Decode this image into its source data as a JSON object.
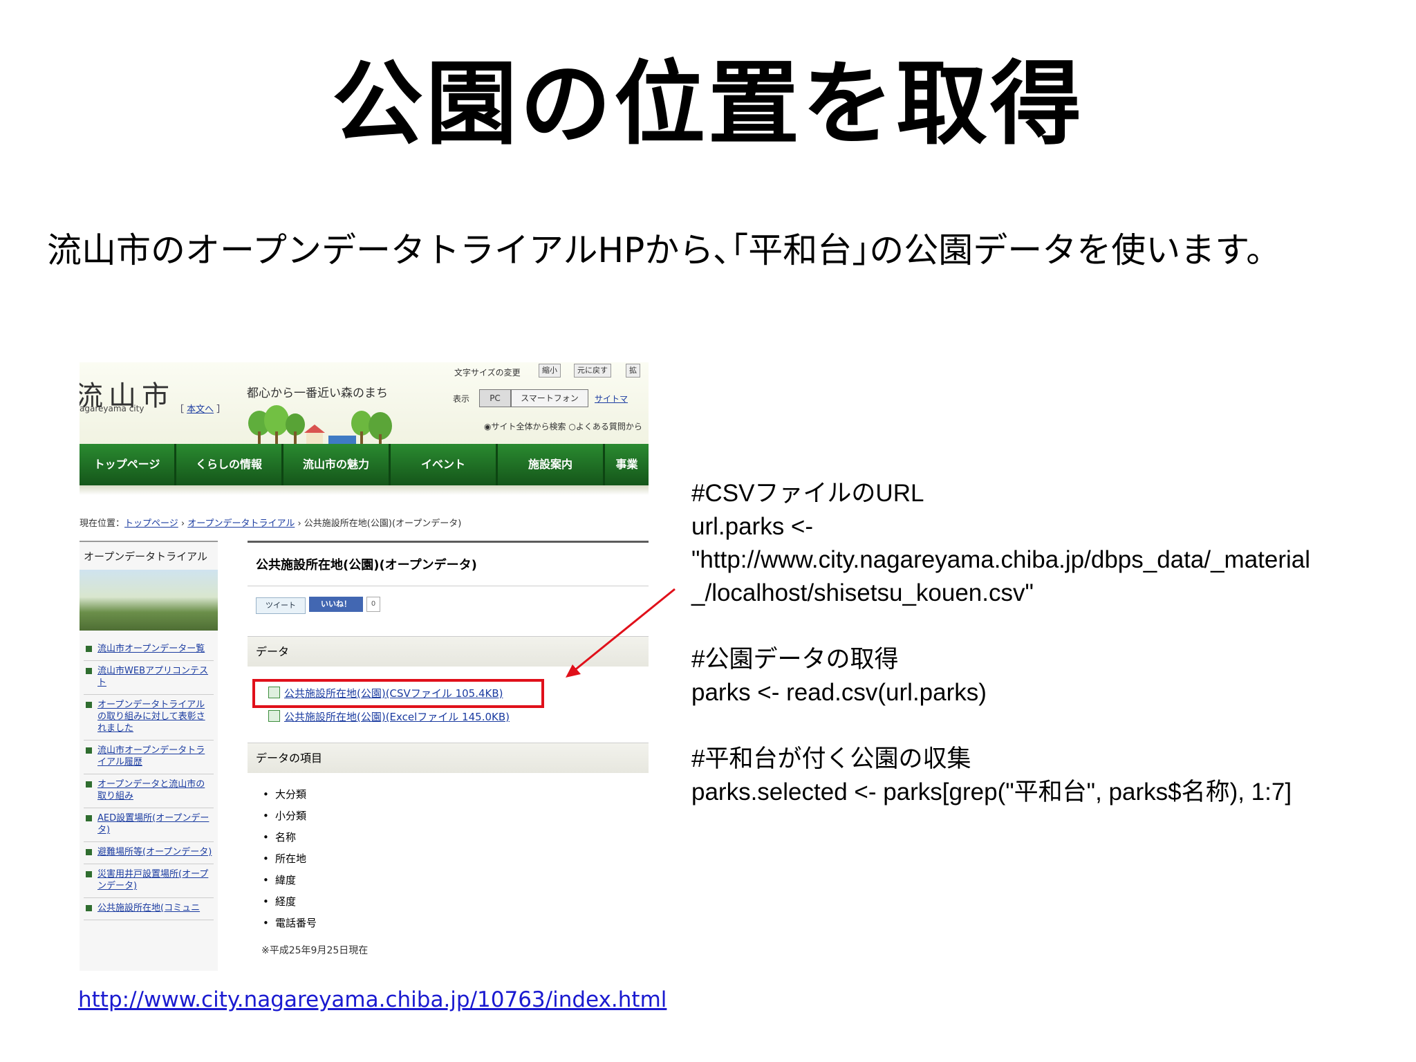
{
  "slide": {
    "title": "公園の位置を取得",
    "subtitle": "流山市のオープンデータトライアルHPから､｢平和台｣の公園データを使います。",
    "url": "http://www.city.nagareyama.chiba.jp/10763/index.html"
  },
  "website": {
    "logo": "流山市",
    "logo_sub": "agareyama city",
    "honbun_link": "本文へ",
    "tagline": "都心から一番近い森のまち",
    "font_size_label": "文字サイズの変更",
    "shrink_btn": "縮小",
    "reset_btn": "元に戻す",
    "enlarge_btn": "拡",
    "display_label": "表示",
    "pc_btn": "PC",
    "smartphone_btn": "スマートフォン",
    "sitemap_link": "サイトマ",
    "search_option_site": "サイト全体から検索",
    "search_option_faq": "よくある質問から",
    "nav": [
      "トップページ",
      "くらしの情報",
      "流山市の魅力",
      "イベント",
      "施設案内",
      "事業"
    ],
    "breadcrumb": {
      "prefix": "現在位置：",
      "links": [
        "トップページ",
        "オープンデータトライアル"
      ],
      "current": "公共施設所在地(公園)(オープンデータ)"
    },
    "sidebar": {
      "title": "オープンデータトライアル",
      "items": [
        "流山市オープンデーター覧",
        "流山市WEBアプリコンテスト",
        "オープンデータトライアルの取り組みに対して表彰されました",
        "流山市オープンデータトライアル履歴",
        "オープンデータと流山市の取り組み",
        "AED設置場所(オープンデータ)",
        "避難場所等(オープンデータ)",
        "災害用井戸設置場所(オープンデータ)",
        "公共施設所在地(コミュニ"
      ]
    },
    "main": {
      "heading": "公共施設所在地(公園)(オープンデータ)",
      "tweet": "ツイート",
      "like": "いいね！",
      "like_count": "0",
      "data_heading": "データ",
      "csv_link": "公共施設所在地(公園)(CSVファイル 105.4KB)",
      "excel_link": "公共施設所在地(公園)(Excelファイル 145.0KB)",
      "items_heading": "データの項目",
      "items": [
        "大分類",
        "小分類",
        "名称",
        "所在地",
        "緯度",
        "経度",
        "電話番号"
      ],
      "note": "※平成25年9月25日現在"
    }
  },
  "code": {
    "comment1": "#CSVファイルのURL",
    "line1": "url.parks <-",
    "line2": "\"http://www.city.nagareyama.chiba.jp/dbps_data/_material",
    "line3": "_/localhost/shisetsu_kouen.csv\"",
    "comment2": "#公園データの取得",
    "line4": "parks <- read.csv(url.parks)",
    "comment3": "#平和台が付く公園の収集",
    "line5": "parks.selected <- parks[grep(\"平和台\", parks$名称), 1:7]"
  },
  "colors": {
    "nav_green": "#1d6a22",
    "highlight_red": "#e0101a",
    "link_blue": "#1a3ba0"
  }
}
